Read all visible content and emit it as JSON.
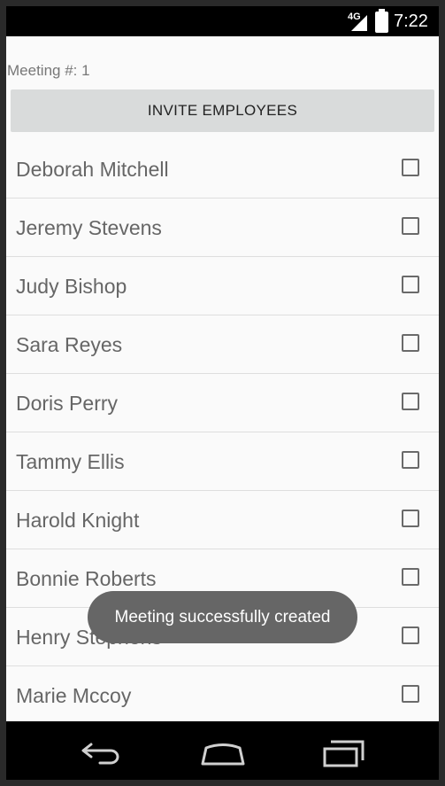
{
  "status_bar": {
    "network": "4G",
    "time": "7:22"
  },
  "meeting": {
    "label": "Meeting #: 1"
  },
  "invite_button": {
    "label": "INVITE EMPLOYEES"
  },
  "employees": [
    {
      "name": "Deborah Mitchell",
      "checked": false
    },
    {
      "name": "Jeremy Stevens",
      "checked": false
    },
    {
      "name": "Judy Bishop",
      "checked": false
    },
    {
      "name": "Sara Reyes",
      "checked": false
    },
    {
      "name": "Doris Perry",
      "checked": false
    },
    {
      "name": "Tammy Ellis",
      "checked": false
    },
    {
      "name": "Harold Knight",
      "checked": false
    },
    {
      "name": "Bonnie Roberts",
      "checked": false
    },
    {
      "name": "Henry Stephens",
      "checked": false
    },
    {
      "name": "Marie Mccoy",
      "checked": false
    }
  ],
  "toast": {
    "message": "Meeting successfully created"
  },
  "nav_bar": {
    "icons": [
      "back-icon",
      "home-icon",
      "recent-apps-icon"
    ]
  }
}
